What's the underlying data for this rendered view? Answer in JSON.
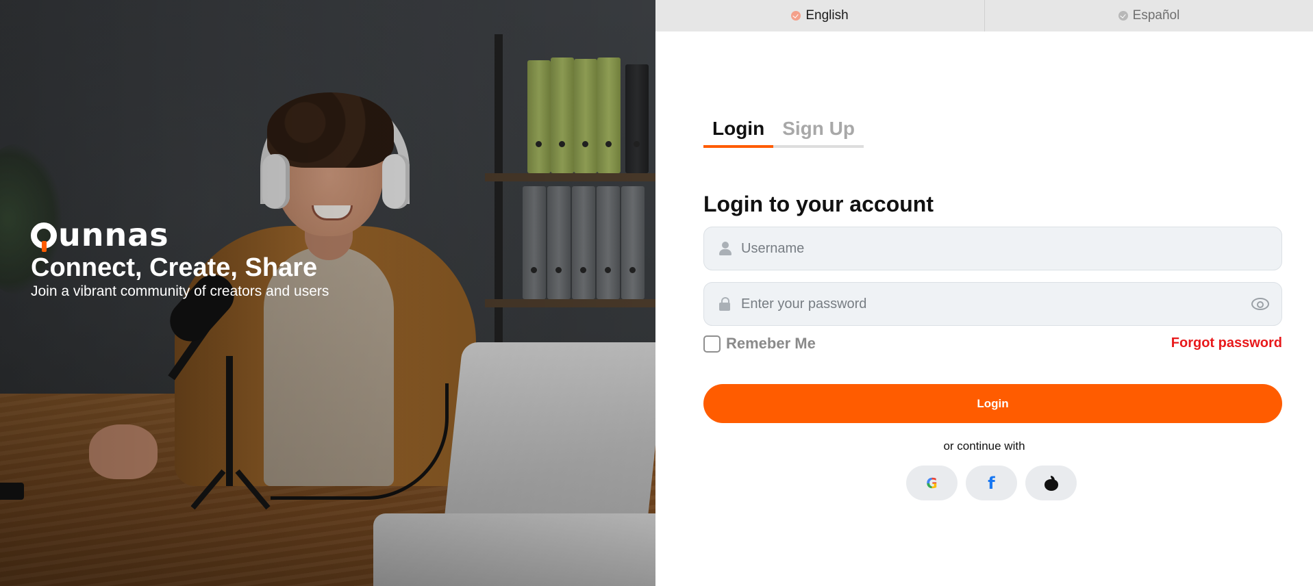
{
  "hero": {
    "brand": "Qunnas",
    "brand_rest": "unnas",
    "title": "Connect, Create, Share",
    "subtitle": "Join a vibrant community of creators and users"
  },
  "language": {
    "options": [
      {
        "label": "English",
        "active": true
      },
      {
        "label": "Español",
        "active": false
      }
    ]
  },
  "auth_tabs": [
    {
      "label": "Login",
      "active": true
    },
    {
      "label": "Sign Up",
      "active": false
    }
  ],
  "form": {
    "title": "Login to your account",
    "username_placeholder": "Username",
    "username_value": "",
    "password_placeholder": "Enter your password",
    "password_value": "",
    "remember_label": "Remeber Me",
    "remember_checked": false,
    "forgot_label": "Forgot password",
    "submit_label": "Login",
    "continue_text": "or continue with"
  },
  "socials": [
    {
      "name": "google",
      "glyph": "G"
    },
    {
      "name": "facebook",
      "glyph": "f"
    },
    {
      "name": "apple",
      "glyph": ""
    }
  ],
  "colors": {
    "accent": "#ff5c00",
    "link_red": "#e8191b",
    "field_bg": "#eff2f5",
    "tab_bar_bg": "#e6e6e6"
  }
}
